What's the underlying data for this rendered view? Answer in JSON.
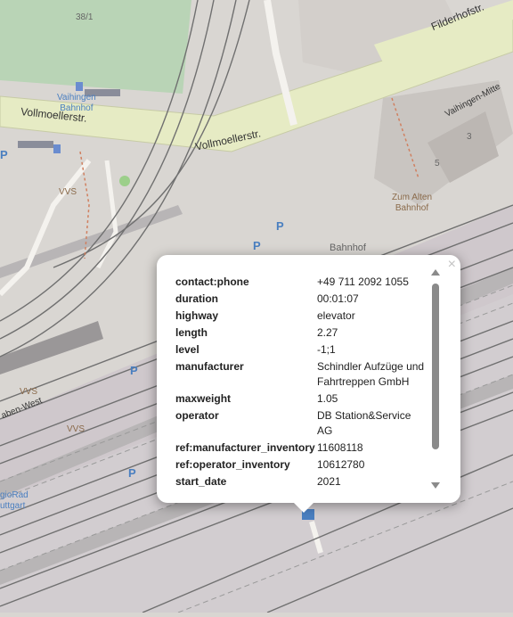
{
  "map": {
    "labels": {
      "housenumber_38_1": "38/1",
      "filderhofstr": "Filderhofstr.",
      "vaihingen_mitte": "Vaihingen-Mitte",
      "vollmoellerstr_1": "Vollmoellerstr.",
      "vollmoellerstr_2": "Vollmoellerstr.",
      "vaihingen_bahnhof": "Vaihingen\nBahnhof",
      "housenumber_3": "3",
      "housenumber_5": "5",
      "zum_alten_bahnhof": "Zum Alten\nBahnhof",
      "vvs_1": "VVS",
      "vvs_2": "VVS",
      "vvs_3": "VVS",
      "bahnhof": "Bahnhof",
      "parking": "P",
      "raben_west": "aben-West",
      "regiorad": "gioRad\nuttgart"
    },
    "colors": {
      "background": "#d9d6d2",
      "park": "#b8d3b4",
      "road_major": "#e2e7c1",
      "rail": "#7a7a7a",
      "rail_area": "#cfc8cc"
    }
  },
  "popup": {
    "close": "×",
    "rows": [
      {
        "key": "contact:phone",
        "value": "+49 711 2092 1055"
      },
      {
        "key": "duration",
        "value": "00:01:07"
      },
      {
        "key": "highway",
        "value": "elevator"
      },
      {
        "key": "length",
        "value": "2.27"
      },
      {
        "key": "level",
        "value": "-1;1"
      },
      {
        "key": "manufacturer",
        "value": "Schindler Aufzüge und Fahrtreppen GmbH"
      },
      {
        "key": "maxweight",
        "value": "1.05"
      },
      {
        "key": "operator",
        "value": "DB Station&Service AG"
      },
      {
        "key": "ref:manufacturer_inventory",
        "value": "11608118"
      },
      {
        "key": "ref:operator_inventory",
        "value": "10612780"
      },
      {
        "key": "start_date",
        "value": "2021"
      }
    ]
  }
}
